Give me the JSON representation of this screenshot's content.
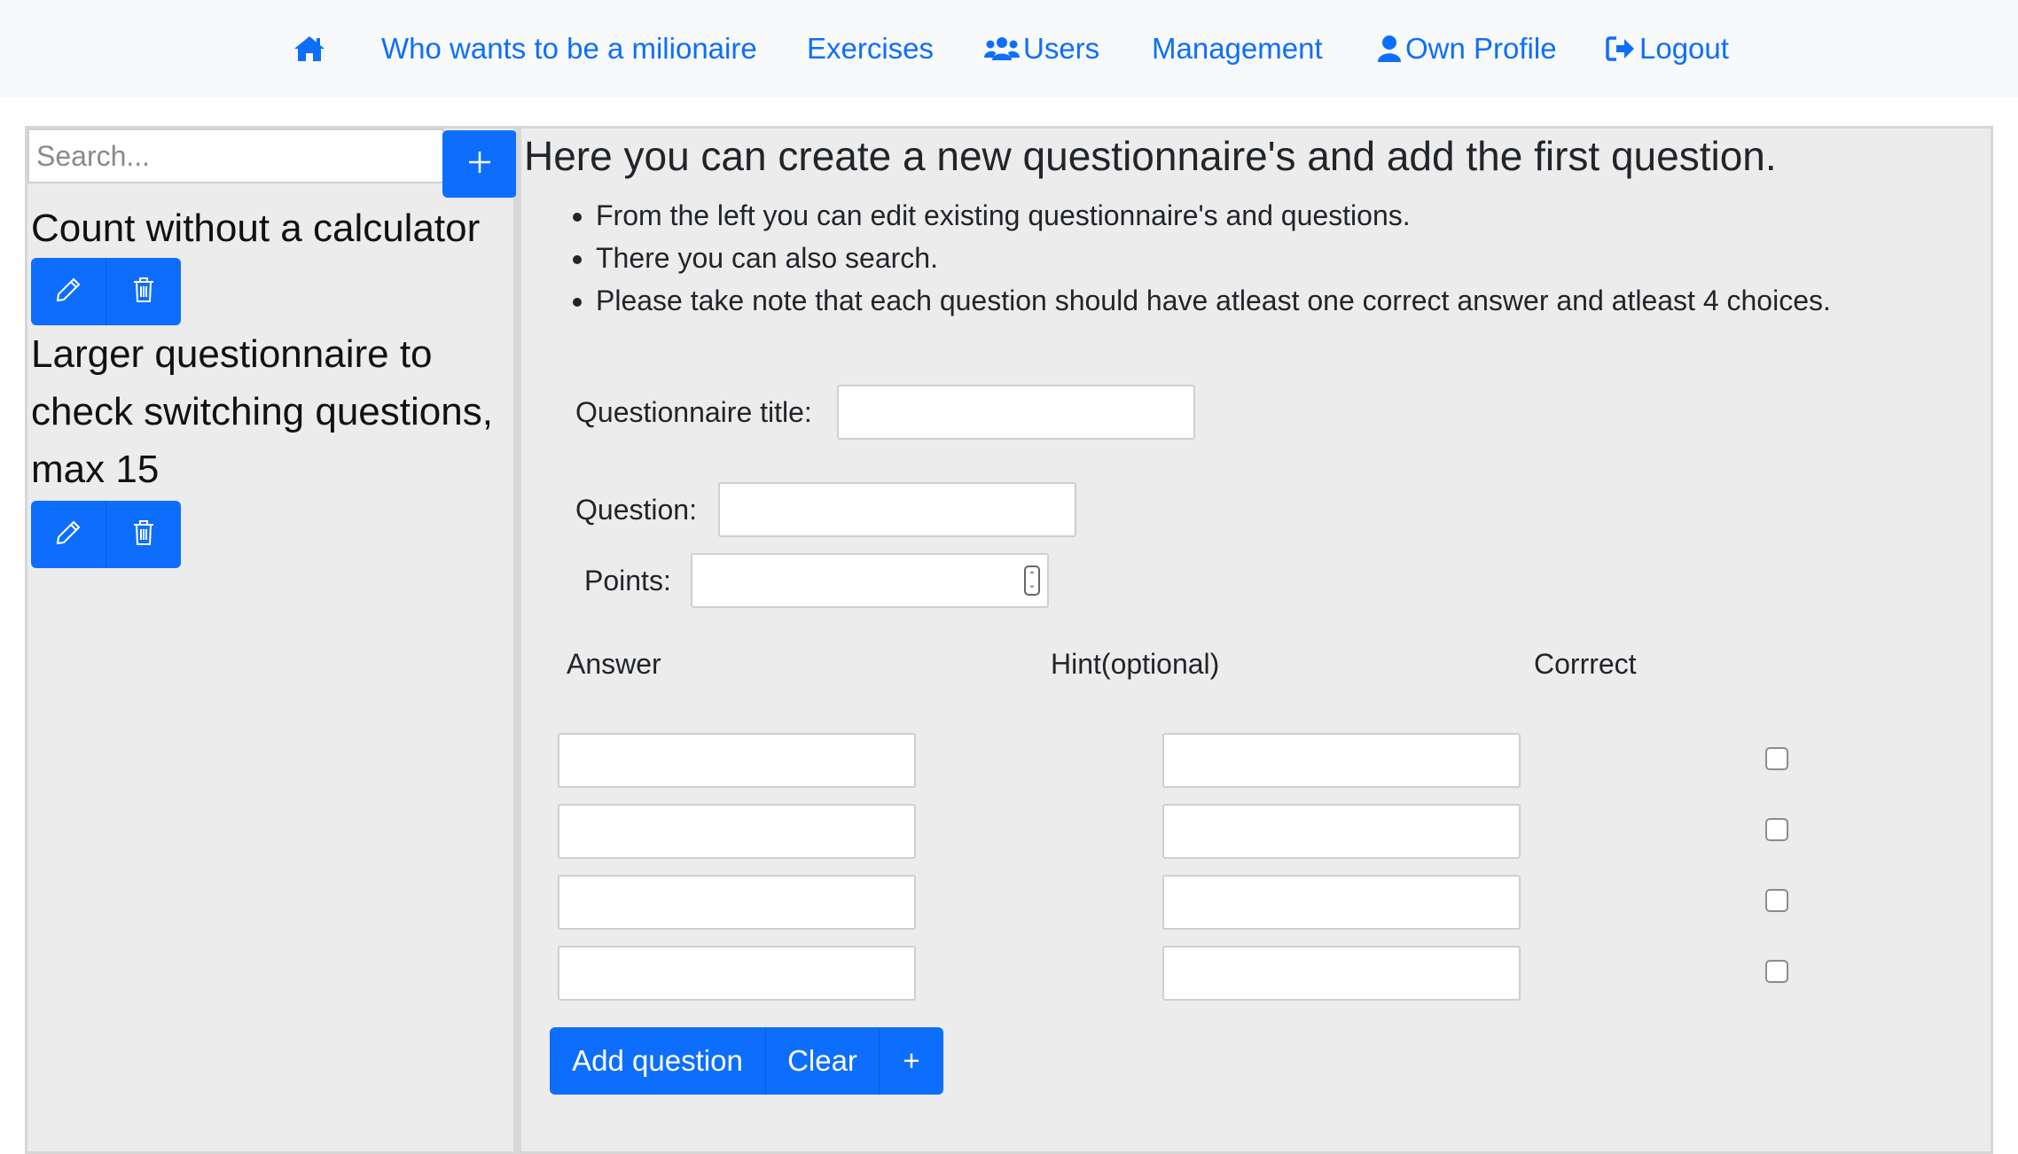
{
  "nav": {
    "home_icon": "home-icon",
    "milionaire_label": "Who wants to be a milionaire",
    "exercises_label": "Exercises",
    "users_icon": "users-icon",
    "users_label": "Users",
    "management_label": "Management",
    "profile_icon": "user-icon",
    "profile_label": "Own Profile",
    "logout_icon": "sign-out-icon",
    "logout_label": "Logout"
  },
  "sidebar": {
    "search_placeholder": "Search...",
    "add_icon": "plus-icon",
    "questionnaires": [
      {
        "title": "Count without a calculator",
        "edit_icon": "pencil-icon",
        "delete_icon": "trash-icon"
      },
      {
        "title": "Larger questionnaire to check switching questions, max 15",
        "edit_icon": "pencil-icon",
        "delete_icon": "trash-icon"
      }
    ]
  },
  "main": {
    "heading": "Here you can create a new questionnaire's and add the first question.",
    "bullets": [
      "From the left you can edit existing questionnaire's and questions.",
      "There you can also search.",
      "Please take note that each question should have atleast one correct answer and atleast 4 choices."
    ],
    "form": {
      "title_label": "Questionnaire title:",
      "title_value": "",
      "question_label": "Question:",
      "question_value": "",
      "points_label": "Points:",
      "points_value": "",
      "answer_header": "Answer",
      "hint_header": "Hint(optional)",
      "correct_header": "Corrrect",
      "rows": [
        {
          "answer": "",
          "hint": "",
          "correct": false
        },
        {
          "answer": "",
          "hint": "",
          "correct": false
        },
        {
          "answer": "",
          "hint": "",
          "correct": false
        },
        {
          "answer": "",
          "hint": "",
          "correct": false
        }
      ]
    },
    "buttons": {
      "add_question": "Add question",
      "clear": "Clear",
      "plus": "+"
    }
  },
  "colors": {
    "primary": "#0d6efd",
    "panel_bg": "#ececec",
    "nav_bg": "#f8f9fa"
  }
}
